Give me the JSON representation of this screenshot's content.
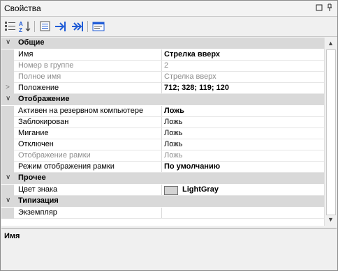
{
  "window": {
    "title": "Свойства",
    "restore_icon": "restore-icon",
    "pin_icon": "pin-icon"
  },
  "toolbar": {
    "buttons": [
      {
        "name": "categorized-view-icon"
      },
      {
        "name": "alphabetical-sort-icon"
      },
      {
        "name": "properties-list-icon"
      },
      {
        "name": "goto-arrow-icon"
      },
      {
        "name": "goto-double-arrow-icon"
      },
      {
        "name": "property-pages-icon"
      }
    ]
  },
  "categories": [
    {
      "label": "Общие",
      "rows": [
        {
          "name": "Имя",
          "value": "Стрелка вверх",
          "bold": true,
          "disabled": false
        },
        {
          "name": "Номер в группе",
          "value": "2",
          "bold": false,
          "disabled": true
        },
        {
          "name": "Полное имя",
          "value": "Стрелка вверх",
          "bold": false,
          "disabled": true
        },
        {
          "name": "Положение",
          "value": "712; 328; 119; 120",
          "bold": true,
          "disabled": false,
          "expandable": true
        }
      ]
    },
    {
      "label": "Отображение",
      "rows": [
        {
          "name": "Активен на резервном компьютере",
          "value": "Ложь",
          "bold": true,
          "disabled": false
        },
        {
          "name": "Заблокирован",
          "value": "Ложь",
          "bold": false,
          "disabled": false
        },
        {
          "name": "Мигание",
          "value": "Ложь",
          "bold": false,
          "disabled": false
        },
        {
          "name": "Отключен",
          "value": "Ложь",
          "bold": false,
          "disabled": false
        },
        {
          "name": "Отображение рамки",
          "value": "Ложь",
          "bold": false,
          "disabled": true
        },
        {
          "name": "Режим отображения рамки",
          "value": "По умолчанию",
          "bold": true,
          "disabled": false
        }
      ]
    },
    {
      "label": "Прочее",
      "rows": [
        {
          "name": "Цвет знака",
          "value": "LightGray",
          "bold": true,
          "disabled": false,
          "swatch": "#d3d3d3"
        }
      ]
    },
    {
      "label": "Типизация",
      "rows": [
        {
          "name": "Экземпляр",
          "value": "",
          "bold": false,
          "disabled": false
        }
      ]
    }
  ],
  "description": {
    "title": "Имя"
  },
  "colors": {
    "category_bg": "#d9d9d9",
    "disabled_text": "#8d8d8d",
    "accent_blue": "#1f5bd6"
  }
}
